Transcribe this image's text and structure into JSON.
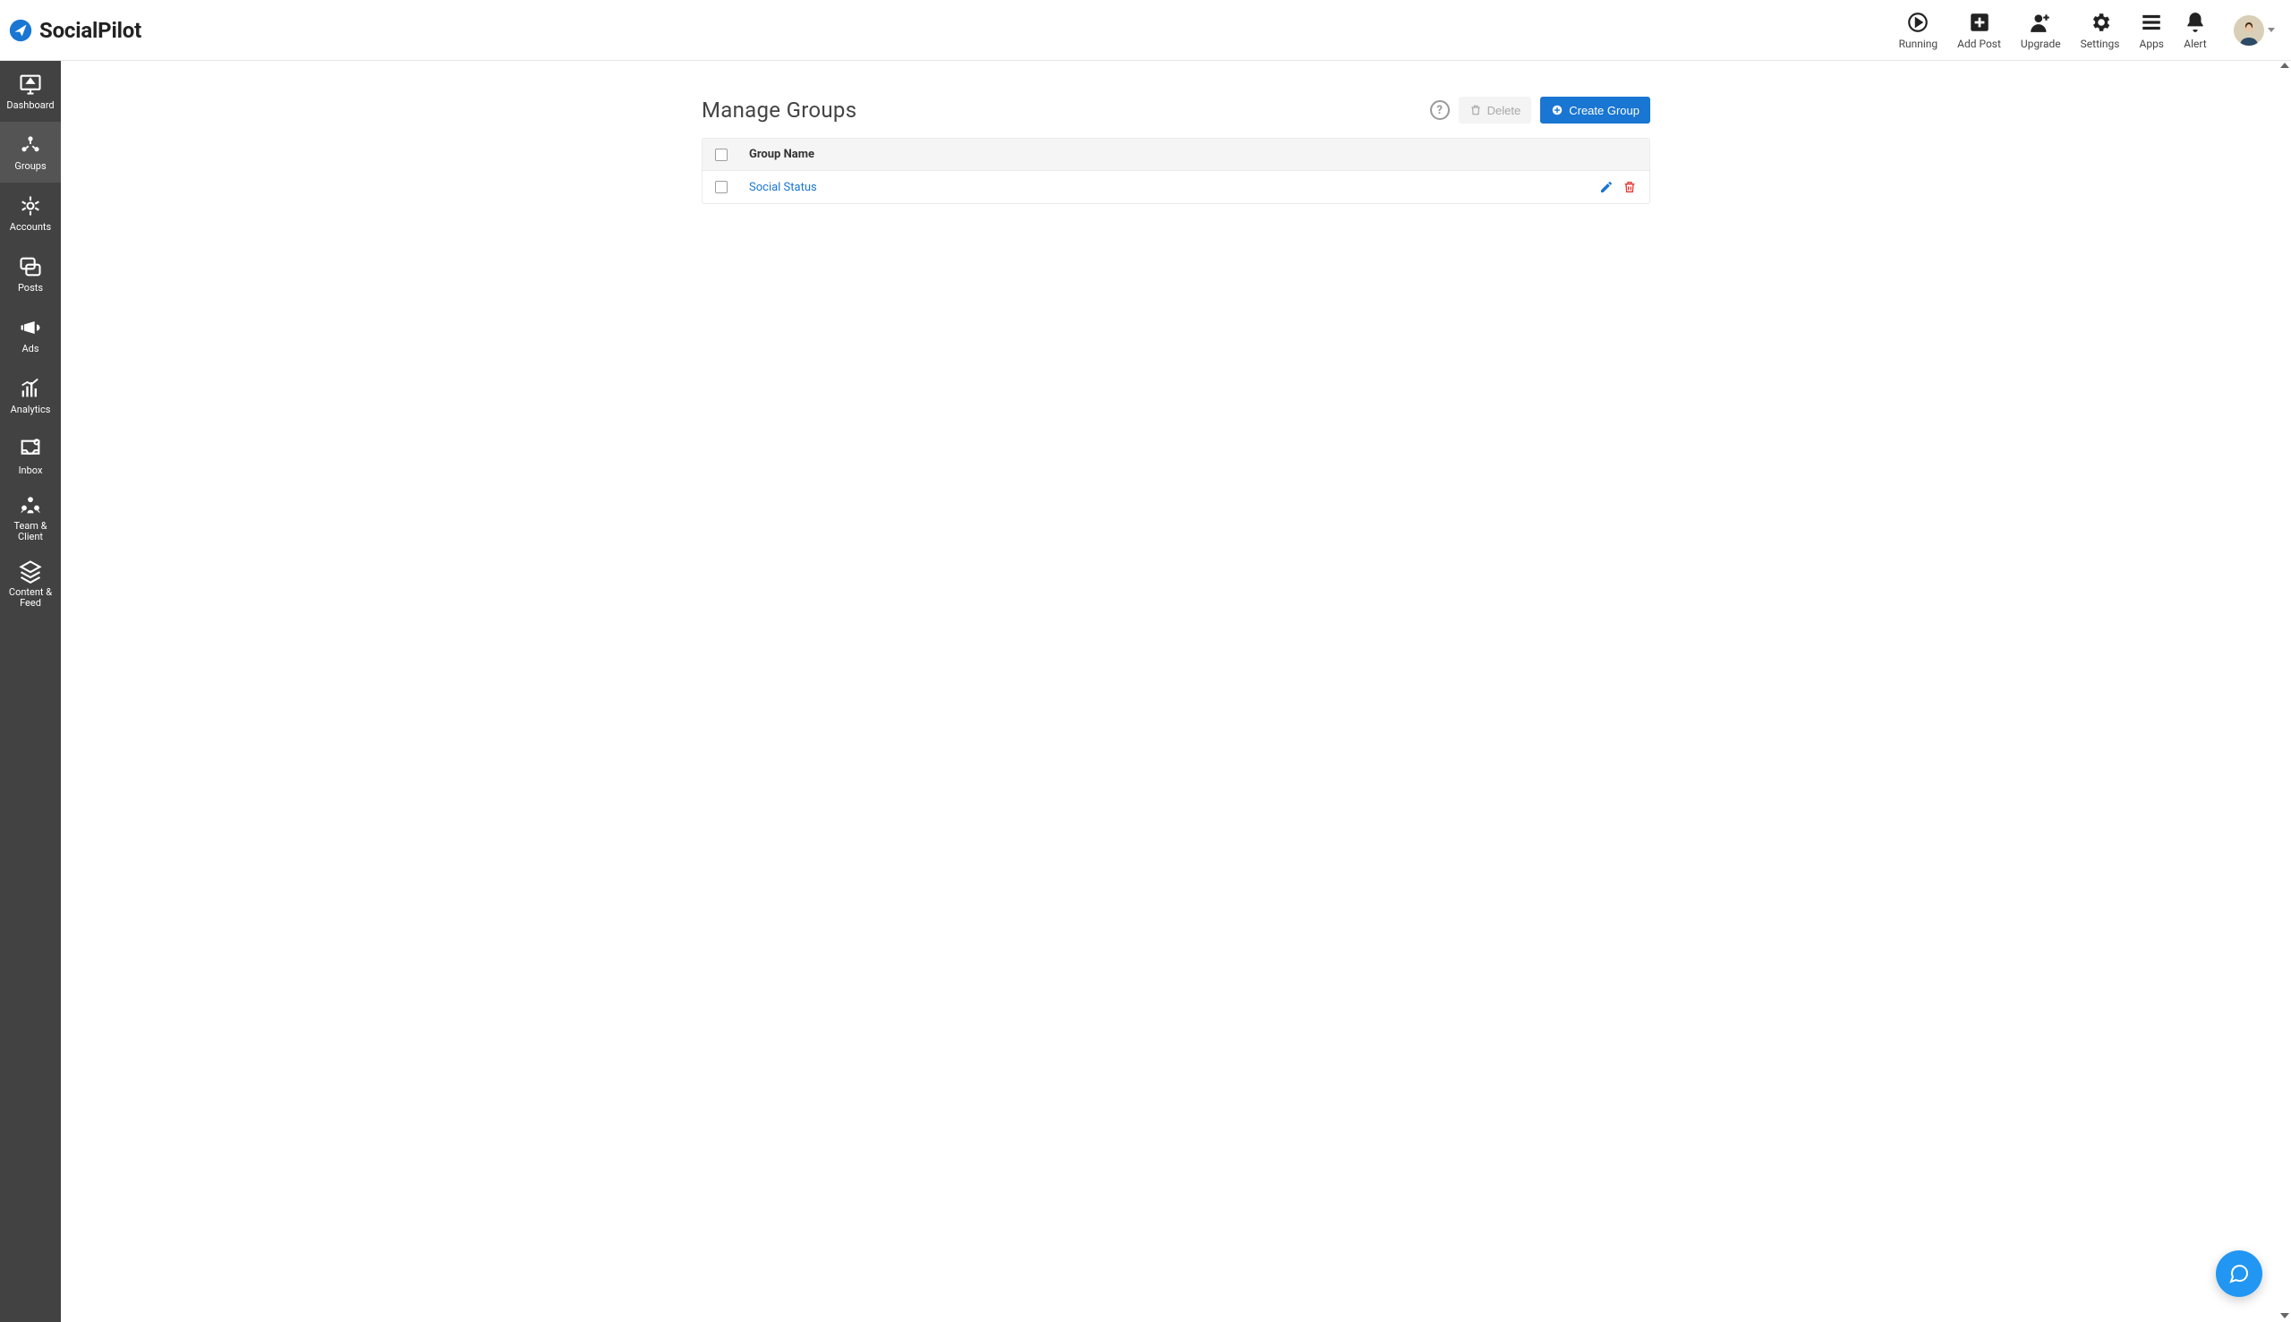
{
  "brand": {
    "name": "SocialPilot"
  },
  "topnav": {
    "running": "Running",
    "add_post": "Add Post",
    "upgrade": "Upgrade",
    "settings": "Settings",
    "apps": "Apps",
    "alert": "Alert"
  },
  "sidebar": {
    "items": [
      {
        "label": "Dashboard"
      },
      {
        "label": "Groups"
      },
      {
        "label": "Accounts"
      },
      {
        "label": "Posts"
      },
      {
        "label": "Ads"
      },
      {
        "label": "Analytics"
      },
      {
        "label": "Inbox"
      },
      {
        "label": "Team & Client"
      },
      {
        "label": "Content & Feed"
      }
    ],
    "active_index": 1
  },
  "page": {
    "title": "Manage Groups",
    "delete_label": "Delete",
    "create_label": "Create Group",
    "column_name": "Group Name"
  },
  "groups": [
    {
      "name": "Social Status"
    }
  ]
}
